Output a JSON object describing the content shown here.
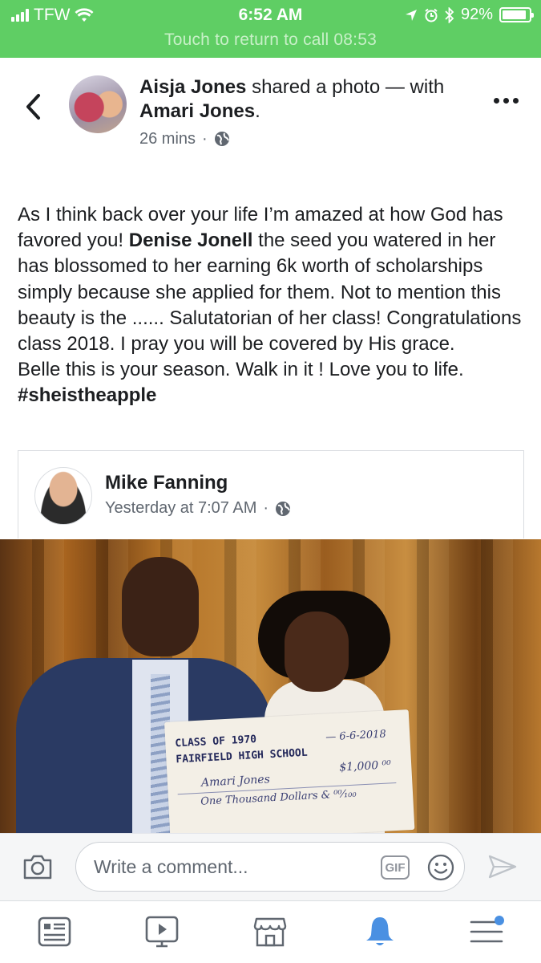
{
  "status_bar": {
    "carrier": "TFW",
    "time": "6:52 AM",
    "battery": "92%",
    "battery_level": 0.92,
    "call_banner": "Touch to return to call 08:53"
  },
  "post": {
    "author": "Aisja Jones",
    "action": " shared a photo — with ",
    "tagged": "Amari Jones",
    "tagged_suffix": ".",
    "time": "26 mins",
    "body": {
      "p1_pre": "As I think back over your life I’m amazed at how God has favored you! ",
      "p1_bold": "Denise Jonell",
      "p1_post": " the seed you watered in her has blossomed to her earning 6k worth of scholarships simply because she applied for them. Not to mention this beauty is the ...... Salutatorian  of her class! Congratulations class 2018. I pray you will be covered by His grace.",
      "p2": "Belle this is your season. Walk in it ! Love you to life.",
      "hashtag": "#sheistheapple"
    }
  },
  "shared": {
    "author": "Mike Fanning",
    "time": "Yesterday at 7:07 AM"
  },
  "photo": {
    "check_line1": "CLASS OF 1970",
    "check_line2": "FAIRFIELD HIGH SCHOOL",
    "check_date": "— 6-6-2018",
    "check_payee": "Amari Jones",
    "check_amount": "$1,000 ⁰⁰",
    "check_words": "One Thousand Dollars & ⁰⁰⁄₁₀₀"
  },
  "comment_bar": {
    "placeholder": "Write a comment...",
    "gif_label": "GIF"
  },
  "icons": [
    "signal-icon",
    "wifi-icon",
    "location-icon",
    "alarm-icon",
    "bluetooth-icon",
    "battery-icon",
    "back-icon",
    "more-icon",
    "globe-icon",
    "camera-icon",
    "gif-icon",
    "emoji-icon",
    "send-icon",
    "news-feed-icon",
    "watch-icon",
    "marketplace-icon",
    "notifications-icon",
    "menu-icon"
  ],
  "colors": {
    "status_green": "#5fce64",
    "facebook_blue": "#4a90e2",
    "text": "#1c1e21",
    "muted": "#606770"
  }
}
